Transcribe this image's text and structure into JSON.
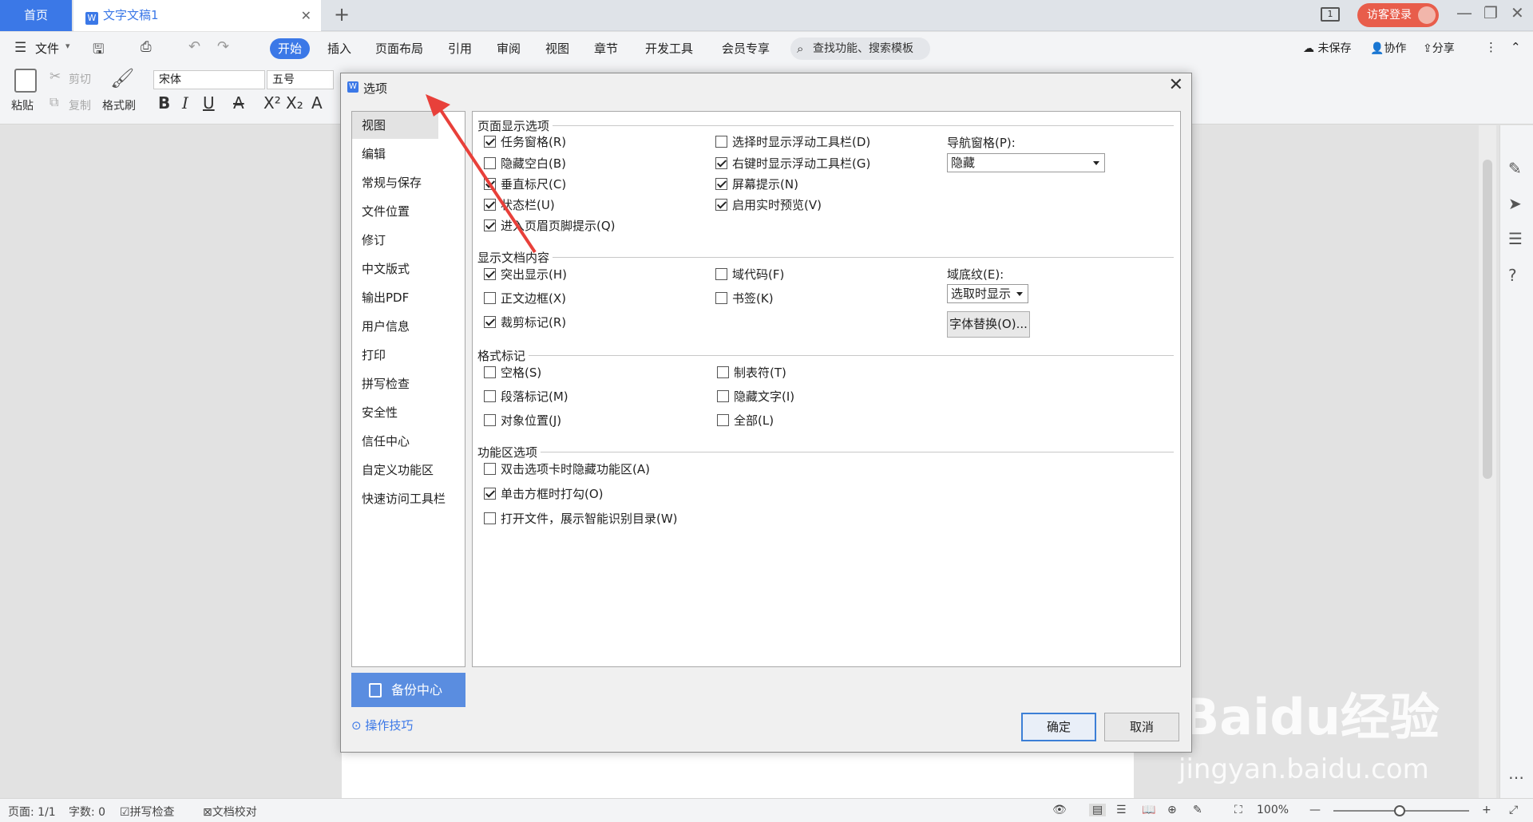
{
  "tabbar": {
    "home": "首页",
    "doc_title": "文字文稿1",
    "new_tab": "+",
    "page_indicator": "1",
    "login": "访客登录"
  },
  "menu": {
    "file": "文件",
    "tabs": [
      "开始",
      "插入",
      "页面布局",
      "引用",
      "审阅",
      "视图",
      "章节",
      "开发工具",
      "会员专享"
    ],
    "search": "查找功能、搜索模板",
    "unsaved": "未保存",
    "collab": "协作",
    "share": "分享"
  },
  "ribbon": {
    "paste": "粘贴",
    "cut": "剪切",
    "copy": "复制",
    "format_painter": "格式刷",
    "font": "宋体",
    "size": "五号"
  },
  "dialog": {
    "title": "选项",
    "nav": [
      "视图",
      "编辑",
      "常规与保存",
      "文件位置",
      "修订",
      "中文版式",
      "输出PDF",
      "用户信息",
      "打印",
      "拼写检查",
      "安全性",
      "信任中心",
      "自定义功能区",
      "快速访问工具栏"
    ],
    "selected_nav": "视图",
    "backup": "备份中心",
    "tips": "操作技巧",
    "sections": {
      "page_display": "页面显示选项",
      "doc_content": "显示文档内容",
      "format_marks": "格式标记",
      "ribbon_options": "功能区选项"
    },
    "page_display": [
      {
        "label": "任务窗格(R)",
        "checked": true
      },
      {
        "label": "隐藏空白(B)",
        "checked": false
      },
      {
        "label": "垂直标尺(C)",
        "checked": true
      },
      {
        "label": "状态栏(U)",
        "checked": true
      },
      {
        "label": "进入页眉页脚提示(Q)",
        "checked": true
      },
      {
        "label": "选择时显示浮动工具栏(D)",
        "checked": false
      },
      {
        "label": "右键时显示浮动工具栏(G)",
        "checked": true
      },
      {
        "label": "屏幕提示(N)",
        "checked": true
      },
      {
        "label": "启用实时预览(V)",
        "checked": true
      }
    ],
    "nav_pane_label": "导航窗格(P):",
    "nav_pane_value": "隐藏",
    "doc_content": [
      {
        "label": "突出显示(H)",
        "checked": true
      },
      {
        "label": "正文边框(X)",
        "checked": false
      },
      {
        "label": "裁剪标记(R)",
        "checked": true
      },
      {
        "label": "域代码(F)",
        "checked": false
      },
      {
        "label": "书签(K)",
        "checked": false
      }
    ],
    "field_shading_label": "域底纹(E):",
    "field_shading_value": "选取时显示",
    "font_substitute": "字体替换(O)...",
    "format_marks": [
      {
        "label": "空格(S)",
        "checked": false
      },
      {
        "label": "段落标记(M)",
        "checked": false
      },
      {
        "label": "对象位置(J)",
        "checked": false
      },
      {
        "label": "制表符(T)",
        "checked": false
      },
      {
        "label": "隐藏文字(I)",
        "checked": false
      },
      {
        "label": "全部(L)",
        "checked": false
      }
    ],
    "ribbon_options": [
      {
        "label": "双击选项卡时隐藏功能区(A)",
        "checked": false
      },
      {
        "label": "单击方框时打勾(O)",
        "checked": true
      },
      {
        "label": "打开文件，展示智能识别目录(W)",
        "checked": false
      }
    ],
    "ok": "确定",
    "cancel": "取消"
  },
  "status": {
    "page": "页面: 1/1",
    "words": "字数: 0",
    "spell": "拼写检查",
    "proof": "文档校对",
    "zoom": "100%"
  },
  "watermark": {
    "brand": "Baidu经验",
    "url": "jingyan.baidu.com"
  },
  "colors": {
    "accent": "#3b78e7",
    "arrow": "#e8403a",
    "login": "#e85d4b"
  }
}
